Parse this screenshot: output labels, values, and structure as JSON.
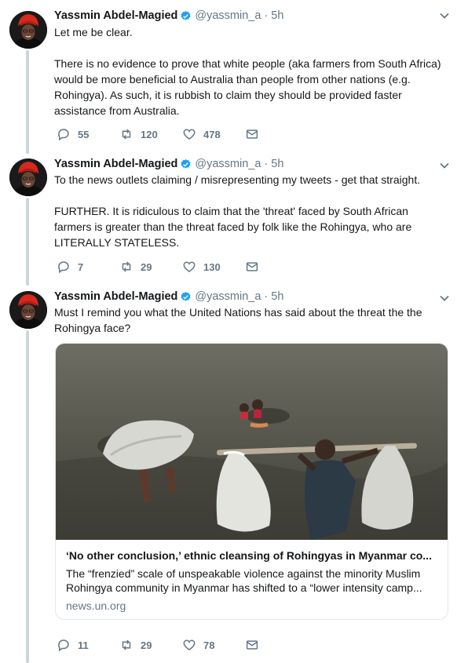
{
  "tweets": [
    {
      "name": "Yassmin Abdel-Magied",
      "handle": "@yassmin_a",
      "time": "· 5h",
      "paragraphs": [
        "Let me be clear.",
        "There is no evidence to prove that white people (aka farmers from South Africa) would be more beneficial to Australia than people from other nations (e.g. Rohingya). As such, it is  rubbish to claim they should be provided faster assistance from Australia."
      ],
      "replies": "55",
      "retweets": "120",
      "likes": "478"
    },
    {
      "name": "Yassmin Abdel-Magied",
      "handle": "@yassmin_a",
      "time": "· 5h",
      "paragraphs": [
        "To the news outlets claiming / misrepresenting my tweets - get that straight.",
        "FURTHER. It is ridiculous to claim that the 'threat' faced by South African farmers is greater than the threat faced by folk like the Rohingya, who are LITERALLY STATELESS."
      ],
      "replies": "7",
      "retweets": "29",
      "likes": "130"
    },
    {
      "name": "Yassmin Abdel-Magied",
      "handle": "@yassmin_a",
      "time": "· 5h",
      "paragraphs": [
        "Must I remind you what the United Nations has said about the threat the the Rohingya face?"
      ],
      "card": {
        "title": "‘No other conclusion,’ ethnic cleansing of Rohingyas in Myanmar co...",
        "description": "The “frenzied” scale of unspeakable violence against the minority Muslim Rohingya community in Myanmar has shifted to a “lower intensity camp...",
        "domain": "news.un.org"
      },
      "replies": "11",
      "retweets": "29",
      "likes": "78"
    }
  ],
  "icons": {
    "reply": "reply-icon",
    "retweet": "retweet-icon",
    "like": "heart-icon",
    "dm": "envelope-icon",
    "verified": "verified-badge-icon",
    "caret": "chevron-down-icon"
  },
  "colors": {
    "text": "#14171a",
    "secondary": "#657786",
    "verified": "#1da1f2",
    "thread": "#ccd6dd",
    "border": "#e1e8ed"
  }
}
